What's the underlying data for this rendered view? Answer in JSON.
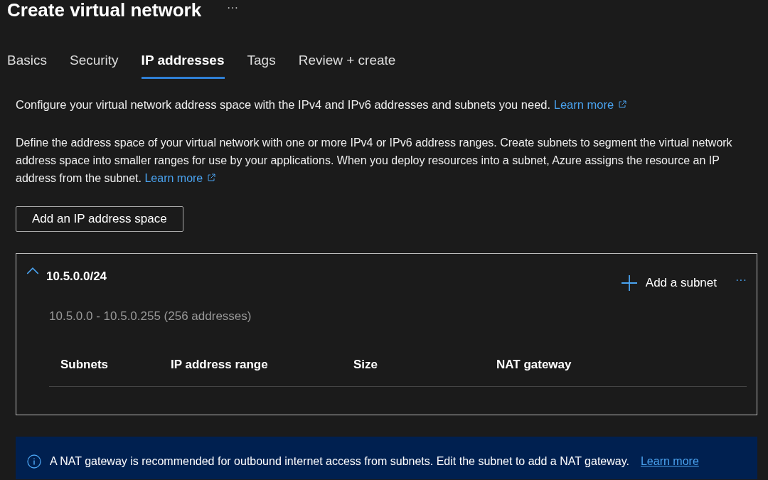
{
  "header": {
    "title": "Create virtual network",
    "more": "···"
  },
  "tabs": [
    {
      "label": "Basics",
      "selected": false
    },
    {
      "label": "Security",
      "selected": false
    },
    {
      "label": "IP addresses",
      "selected": true
    },
    {
      "label": "Tags",
      "selected": false
    },
    {
      "label": "Review + create",
      "selected": false
    }
  ],
  "intro": {
    "text": "Configure your virtual network address space with the IPv4 and IPv6 addresses and subnets you need.",
    "link": "Learn more"
  },
  "description": {
    "text": "Define the address space of your virtual network with one or more IPv4 or IPv6 address ranges. Create subnets to segment the virtual network address space into smaller ranges for use by your applications. When you deploy resources into a subnet, Azure assigns the resource an IP address from the subnet.",
    "link": "Learn more"
  },
  "add_space_button": "Add an IP address space",
  "address_space": {
    "prefix": "10.5.0.0/24",
    "expanded": true,
    "range": "10.5.0.0 - 10.5.0.255 (256 addresses)",
    "add_subnet": "Add a subnet",
    "more": "···",
    "columns": [
      "Subnets",
      "IP address range",
      "Size",
      "NAT gateway"
    ]
  },
  "banner": {
    "text": "A NAT gateway is recommended for outbound internet access from subnets. Edit the subnet to add a NAT gateway.",
    "link": "Learn more"
  }
}
